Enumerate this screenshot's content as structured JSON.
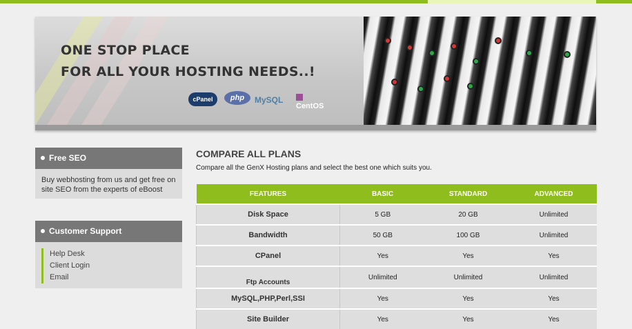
{
  "banner": {
    "line1": "ONE STOP PLACE",
    "line2": "FOR ALL YOUR HOSTING NEEDS..!",
    "logos": {
      "cpanel": "cPanel",
      "php": "php",
      "mysql": "MySQL",
      "centos": "CentOS"
    }
  },
  "sidebar": {
    "seo": {
      "title": "Free SEO",
      "text": "Buy webhosting from us and get free on site SEO from the experts of eBoost"
    },
    "support": {
      "title": "Customer Support",
      "links": [
        "Help Desk",
        "Client Login",
        "Email"
      ]
    }
  },
  "main": {
    "title": "COMPARE ALL PLANS",
    "subtitle": "Compare all the GenX Hosting plans and select the best one which suits you.",
    "table": {
      "headers": [
        "FEATURES",
        "BASIC",
        "STANDARD",
        "ADVANCED"
      ],
      "rows": [
        {
          "feature": "Disk Space",
          "basic": "5 GB",
          "standard": "20 GB",
          "advanced": "Unlimited"
        },
        {
          "feature": "Bandwidth",
          "basic": "50 GB",
          "standard": "100 GB",
          "advanced": "Unlimited"
        },
        {
          "feature": "CPanel",
          "basic": "Yes",
          "standard": "Yes",
          "advanced": "Yes"
        },
        {
          "feature": "Ftp Accounts",
          "basic": "Unlimited",
          "standard": "Unlimited",
          "advanced": "Unlimited"
        },
        {
          "feature": "MySQL,PHP,Perl,SSI",
          "basic": "Yes",
          "standard": "Yes",
          "advanced": "Yes"
        },
        {
          "feature": "Site Builder",
          "basic": "Yes",
          "standard": "Yes",
          "advanced": "Yes"
        }
      ]
    }
  },
  "colors": {
    "accent": "#8fbd1e",
    "panel_header": "#777777",
    "table_row": "#dedede"
  }
}
